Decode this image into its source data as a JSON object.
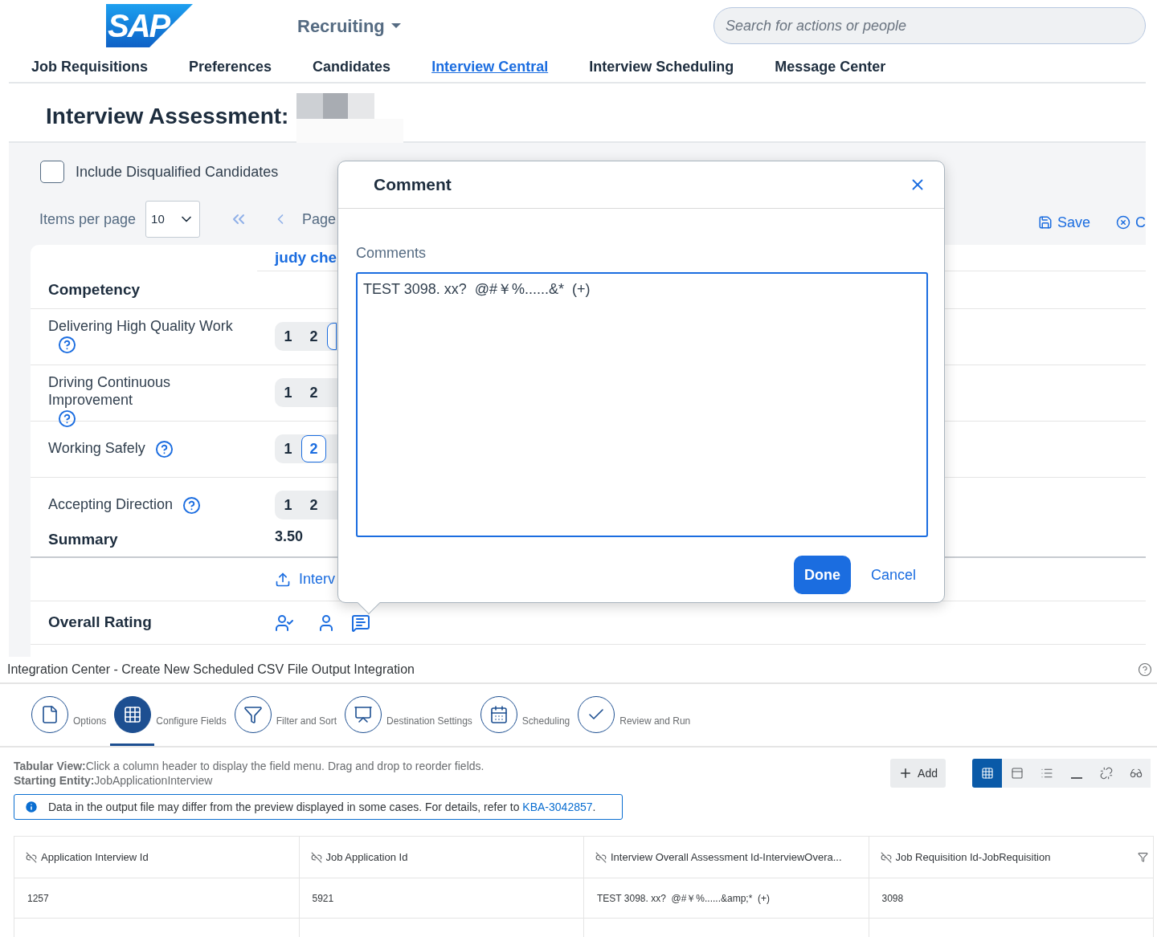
{
  "header": {
    "logo": "SAP",
    "module": "Recruiting",
    "search": {
      "placeholder": "Search for actions or people"
    }
  },
  "nav_tabs": [
    {
      "label": "Job Requisitions",
      "selected": false
    },
    {
      "label": "Preferences",
      "selected": false
    },
    {
      "label": "Candidates",
      "selected": false
    },
    {
      "label": "Interview Central",
      "selected": true
    },
    {
      "label": "Interview Scheduling",
      "selected": false
    },
    {
      "label": "Message Center",
      "selected": false
    }
  ],
  "page_title": "Interview Assessment:",
  "filters": {
    "include_disqualified": {
      "label": "Include Disqualified Candidates",
      "checked": false
    },
    "items_per_page": {
      "label": "Items per page",
      "value": "10"
    },
    "page_label": "Page"
  },
  "actions": [
    {
      "kind": "save",
      "label": "Save"
    },
    {
      "kind": "cancel",
      "label": "C"
    }
  ],
  "assessment": {
    "candidate": "judy che",
    "competency_header": "Competency",
    "competencies": [
      {
        "name": "Delivering High Quality Work",
        "options": [
          {
            "label": "1",
            "selected": false
          },
          {
            "label": "2",
            "selected": false
          },
          {
            "selected": true
          }
        ]
      },
      {
        "name": "Driving Continuous Improvement",
        "options": [
          {
            "label": "1",
            "selected": false
          },
          {
            "label": "2",
            "selected": false
          }
        ]
      },
      {
        "name": "Working Safely",
        "options": [
          {
            "label": "1",
            "selected": false
          },
          {
            "label": "2",
            "selected": true
          }
        ]
      },
      {
        "name": "Accepting Direction",
        "options": [
          {
            "label": "1",
            "selected": false
          },
          {
            "label": "2",
            "selected": false
          }
        ]
      }
    ],
    "summary": {
      "label": "Summary",
      "value": "3.50"
    },
    "upload_label": "Interv",
    "overall": {
      "label": "Overall Rating"
    }
  },
  "comment_dialog": {
    "title": "Comment",
    "field_label": "Comments",
    "value": "TEST 3098. xx?  @#￥%......&*  (+)",
    "buttons": [
      {
        "kind": "primary",
        "label": "Done"
      },
      {
        "kind": "secondary",
        "label": "Cancel"
      }
    ]
  },
  "integration": {
    "title": "Integration Center - Create New Scheduled CSV File Output Integration",
    "steps": [
      {
        "kind": "options",
        "label": "Options",
        "selected": false
      },
      {
        "kind": "fields",
        "label": "Configure Fields",
        "selected": true
      },
      {
        "kind": "filter",
        "label": "Filter and Sort",
        "selected": false
      },
      {
        "kind": "destination",
        "label": "Destination Settings",
        "selected": false
      },
      {
        "kind": "schedule",
        "label": "Scheduling",
        "selected": false
      },
      {
        "kind": "review",
        "label": "Review and Run",
        "selected": false
      }
    ],
    "tabular_view": "**Tabular View:**Click a column header to display the field menu. Drag and drop to reorder fields.",
    "starting_entity": "**Starting Entity:**JobApplicationInterview",
    "info": {
      "text": "Data in the output file may differ from the preview displayed in some cases. For details, refer to ",
      "link": "KBA-3042857",
      "suffix": "."
    },
    "add_button": "Add",
    "view_toggles": [
      {
        "kind": "grid",
        "selected": true
      },
      {
        "kind": "panel",
        "selected": false
      },
      {
        "kind": "list",
        "selected": false
      },
      {
        "kind": "line",
        "selected": false
      },
      {
        "kind": "unlink",
        "selected": false
      },
      {
        "kind": "glasses",
        "selected": false
      }
    ],
    "table": {
      "columns": [
        {
          "label": "Application Interview Id",
          "filter": false
        },
        {
          "label": "Job Application Id",
          "filter": false
        },
        {
          "label": "Interview Overall Assessment Id-InterviewOvera...",
          "filter": false
        },
        {
          "label": "Job Requisition Id-JobRequisition",
          "filter": true
        }
      ],
      "rows": [
        [
          "1257",
          "5921",
          "TEST 3098. xx?  @#￥%......&amp;*  (+)",
          "3098"
        ]
      ]
    }
  }
}
